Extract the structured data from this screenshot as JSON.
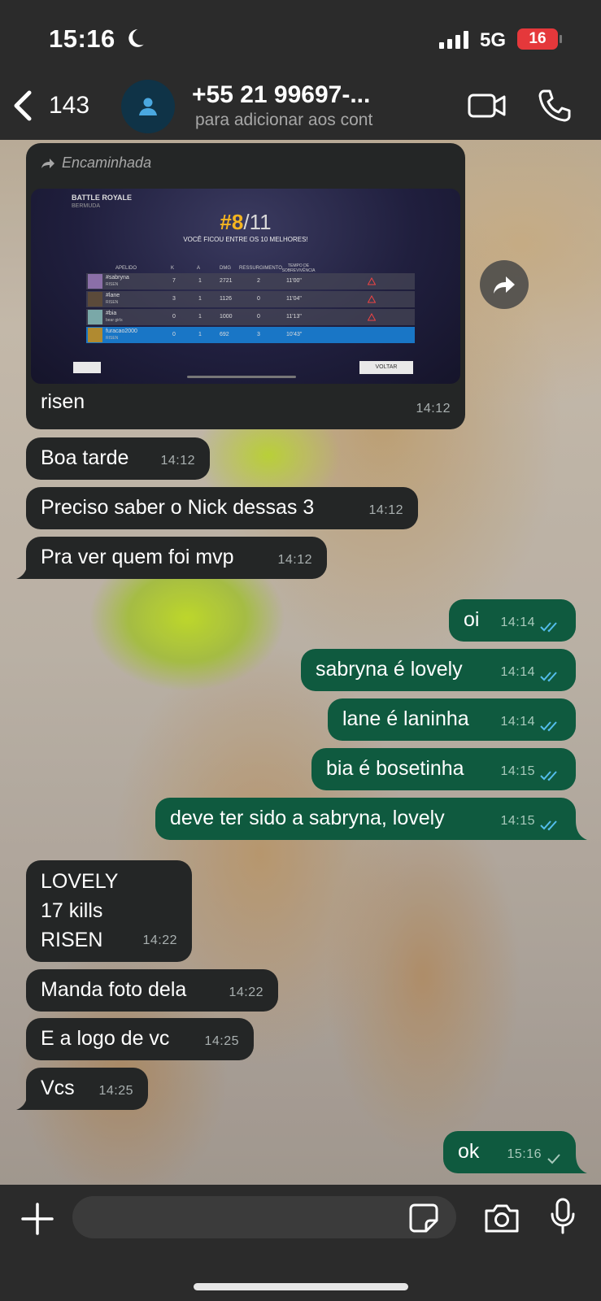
{
  "status_bar": {
    "time": "15:16",
    "network": "5G",
    "battery": "16"
  },
  "header": {
    "back_count": "143",
    "contact_name": "+55 21 99697-...",
    "contact_subtitle": "para adicionar aos cont"
  },
  "forwarded": {
    "label": "Encaminhada",
    "caption": "risen",
    "time": "14:12",
    "screenshot": {
      "mode": "BATTLE ROYALE",
      "map": "BERMUDA",
      "rank": "#8",
      "rank_total": "/11",
      "subtitle": "VOCÊ FICOU ENTRE OS 10 MELHORES!",
      "columns": [
        "APELIDO",
        "K",
        "A",
        "DMG",
        "RESSURGIMENTO",
        "TEMPO DE SOBREVIVÊNCIA"
      ],
      "rows": [
        {
          "nick": "#sabryna",
          "team": "RISEN",
          "k": "7",
          "a": "1",
          "dmg": "2721",
          "res": "2",
          "time": "11'00\""
        },
        {
          "nick": "#lane",
          "team": "RISEN",
          "k": "3",
          "a": "1",
          "dmg": "1126",
          "res": "0",
          "time": "11'04\""
        },
        {
          "nick": "#bia",
          "team": "bear girls",
          "k": "0",
          "a": "1",
          "dmg": "1000",
          "res": "0",
          "time": "11'13\""
        },
        {
          "nick": "furacao2000",
          "team": "RISEN",
          "k": "0",
          "a": "1",
          "dmg": "692",
          "res": "3",
          "time": "10'43\""
        }
      ],
      "back_button": "VOLTAR"
    }
  },
  "messages": [
    {
      "dir": "in",
      "text": "Boa tarde",
      "time": "14:12"
    },
    {
      "dir": "in",
      "text": "Preciso saber o Nick dessas 3",
      "time": "14:12"
    },
    {
      "dir": "in",
      "text": "Pra ver quem foi mvp",
      "time": "14:12"
    },
    {
      "dir": "out",
      "text": "oi",
      "time": "14:14"
    },
    {
      "dir": "out",
      "text": "sabryna é lovely",
      "time": "14:14"
    },
    {
      "dir": "out",
      "text": "lane é laninha",
      "time": "14:14"
    },
    {
      "dir": "out",
      "text": "bia é bosetinha",
      "time": "14:15"
    },
    {
      "dir": "out",
      "text": "deve ter sido a sabryna, lovely",
      "time": "14:15"
    },
    {
      "dir": "in",
      "lines": [
        "LOVELY",
        "17 kills",
        "RISEN"
      ],
      "time": "14:22"
    },
    {
      "dir": "in",
      "text": "Manda foto dela",
      "time": "14:22"
    },
    {
      "dir": "in",
      "text": "E a logo de vc",
      "time": "14:25"
    },
    {
      "dir": "in",
      "text": "Vcs",
      "time": "14:25"
    },
    {
      "dir": "out",
      "text": "ok",
      "time": "15:16"
    }
  ],
  "composer": {
    "placeholder": ""
  },
  "colors": {
    "incoming": "#242626",
    "outgoing": "#0f5a3f",
    "read_ticks": "#53bdeb",
    "bar": "#2b2b2b"
  }
}
